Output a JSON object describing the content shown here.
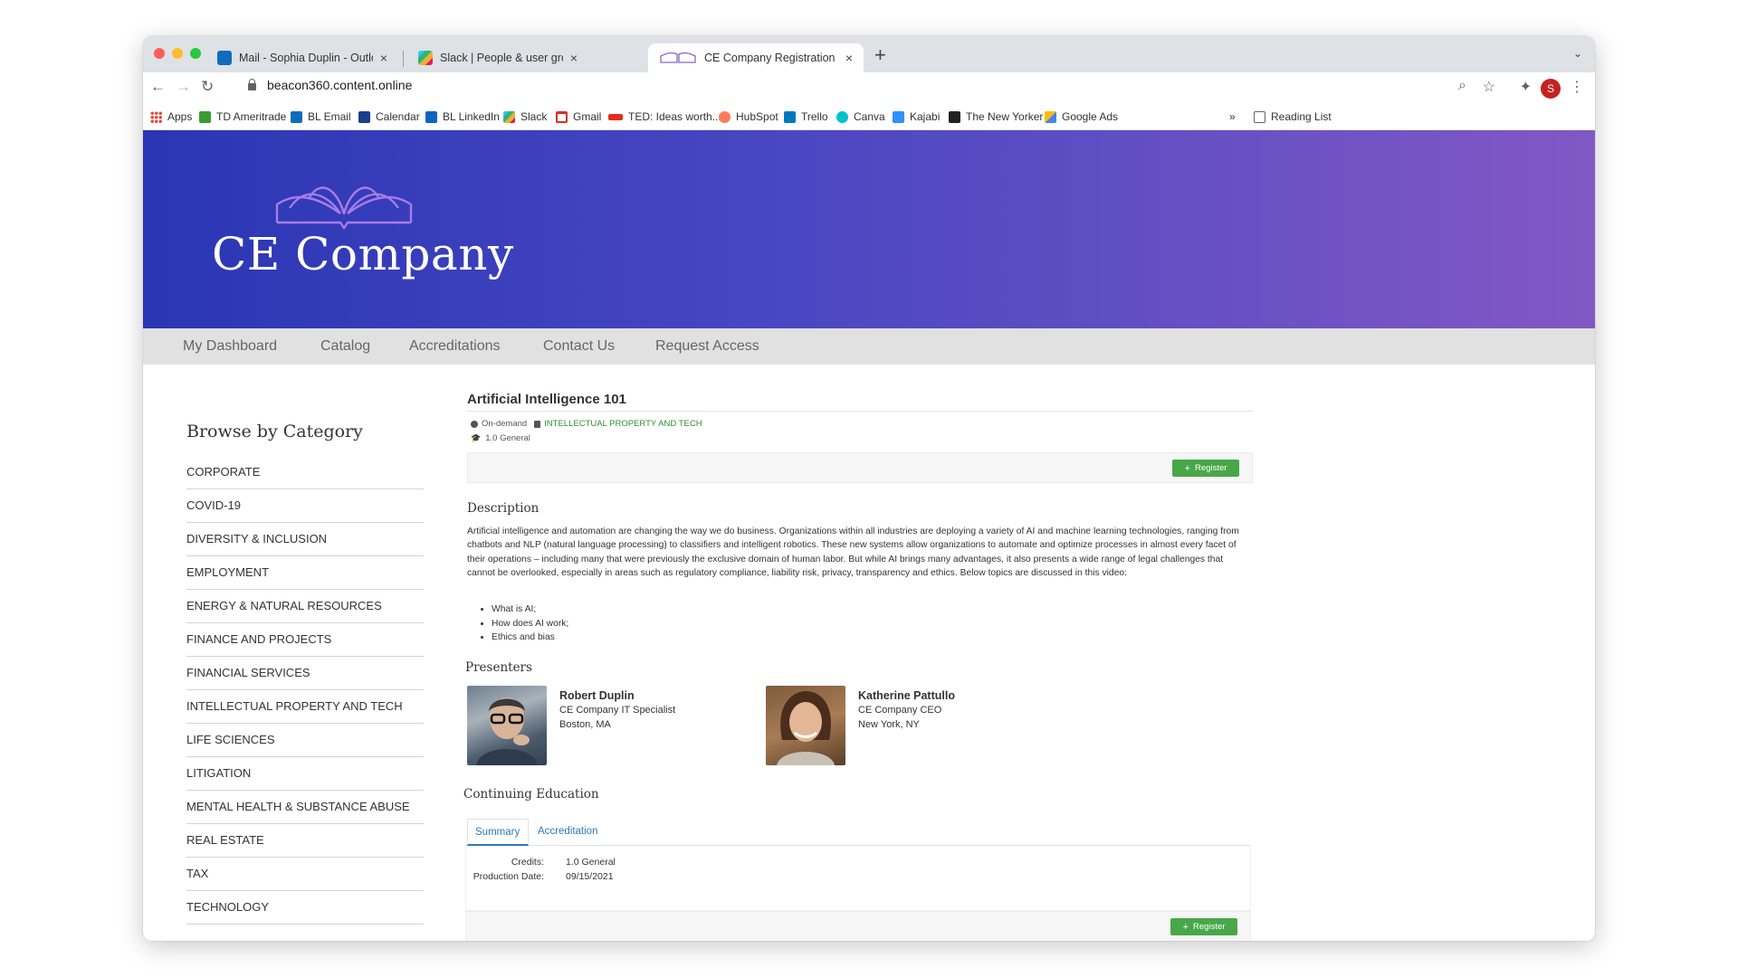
{
  "browser": {
    "tabs": [
      {
        "label": "Mail - Sophia Duplin - Outlook",
        "close": "×"
      },
      {
        "label": "Slack | People & user groups |",
        "close": "×"
      },
      {
        "label": "CE Company Registration",
        "close": "×"
      }
    ],
    "new_tab": "+",
    "tab_menu": "⌄",
    "url": "beacon360.content.online",
    "avatar_letter": "S",
    "bookmarks": [
      {
        "label": "Apps",
        "color": "#5f6368"
      },
      {
        "label": "TD Ameritrade",
        "color": "#3a9b35"
      },
      {
        "label": "BL Email",
        "color": "#0f6cbd"
      },
      {
        "label": "Calendar",
        "color": "#1a3d8f"
      },
      {
        "label": "BL LinkedIn",
        "color": "#0a66c2"
      },
      {
        "label": "Slack",
        "color": "#e01e5a"
      },
      {
        "label": "Gmail",
        "color": "#d93025"
      },
      {
        "label": "TED: Ideas worth...",
        "color": "#e62b1e"
      },
      {
        "label": "HubSpot",
        "color": "#ff7a59"
      },
      {
        "label": "Trello",
        "color": "#0079bf"
      },
      {
        "label": "Canva",
        "color": "#00c4cc"
      },
      {
        "label": "Kajabi",
        "color": "#2e91fc"
      },
      {
        "label": "The New Yorker",
        "color": "#222222"
      },
      {
        "label": "Google Ads",
        "color": "#fbbc04"
      }
    ],
    "bookmarks_overflow": "»",
    "reading_list": "Reading List"
  },
  "site": {
    "brand": "CE Company",
    "nav": [
      "My Dashboard",
      "Catalog",
      "Accreditations",
      "Contact Us",
      "Request Access"
    ]
  },
  "sidebar": {
    "title": "Browse by Category",
    "categories": [
      "CORPORATE",
      "COVID-19",
      "DIVERSITY & INCLUSION",
      "EMPLOYMENT",
      "ENERGY & NATURAL RESOURCES",
      "FINANCE AND PROJECTS",
      "FINANCIAL SERVICES",
      "INTELLECTUAL PROPERTY AND TECH",
      "LIFE SCIENCES",
      "LITIGATION",
      "MENTAL HEALTH & SUBSTANCE ABUSE",
      "REAL ESTATE",
      "TAX",
      "TECHNOLOGY"
    ]
  },
  "course": {
    "title": "Artificial Intelligence 101",
    "format": "On-demand",
    "category": "INTELLECTUAL PROPERTY AND TECH",
    "credits_badge": "1.0 General",
    "register_label": "Register",
    "description_heading": "Description",
    "description": "Artificial intelligence and automation are changing the way we do business. Organizations within all industries are deploying a variety of AI and machine learning technologies, ranging from chatbots and NLP (natural language processing) to classifiers and intelligent robotics. These new systems allow organizations to automate and optimize processes in almost every facet of their operations – including many that were previously the exclusive domain of human labor. But while AI brings many advantages, it also presents a wide range of legal challenges that cannot be overlooked, especially in areas such as regulatory compliance, liability risk, privacy, transparency and ethics. Below topics are discussed in this video:",
    "topics": [
      "What is AI;",
      "How does AI work;",
      "Ethics and bias"
    ],
    "presenters_heading": "Presenters",
    "presenters": [
      {
        "name": "Robert Duplin",
        "role": "CE Company IT Specialist",
        "location": "Boston, MA"
      },
      {
        "name": "Katherine Pattullo",
        "role": "CE Company CEO",
        "location": "New York, NY"
      }
    ],
    "ce_heading": "Continuing Education",
    "ce_tabs": [
      "Summary",
      "Accreditation"
    ],
    "ce_summary": {
      "credits_label": "Credits:",
      "credits_value": "1.0 General",
      "production_label": "Production Date:",
      "production_value": "09/15/2021"
    }
  }
}
